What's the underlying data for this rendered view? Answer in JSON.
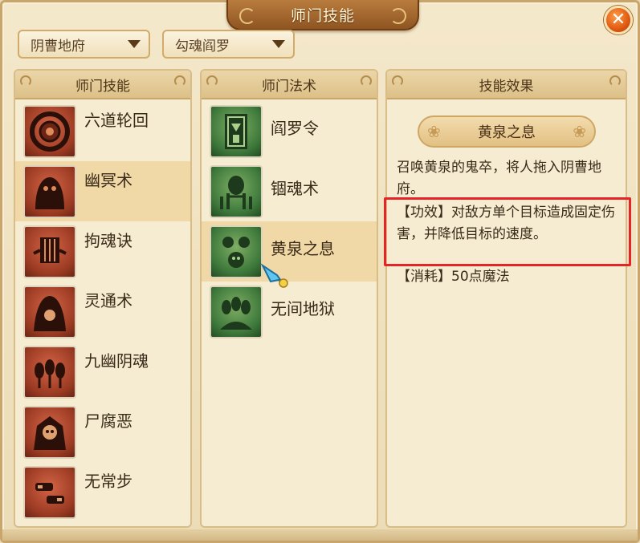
{
  "window": {
    "title": "师门技能",
    "close_label": "✕"
  },
  "dropdowns": [
    {
      "selected": "阴曹地府"
    },
    {
      "selected": "勾魂阎罗"
    }
  ],
  "school_panel": {
    "header": "师门技能",
    "items": [
      {
        "label": "六道轮回",
        "icon": "ring-icon"
      },
      {
        "label": "幽冥术",
        "icon": "ghosts-icon",
        "selected": true
      },
      {
        "label": "拘魂诀",
        "icon": "cage-ghost-icon"
      },
      {
        "label": "灵通术",
        "icon": "hooded-figure-icon"
      },
      {
        "label": "九幽阴魂",
        "icon": "three-spirits-icon"
      },
      {
        "label": "尸腐恶",
        "icon": "skull-icon"
      },
      {
        "label": "无常步",
        "icon": "footsteps-icon"
      }
    ]
  },
  "spell_panel": {
    "header": "师门法术",
    "items": [
      {
        "label": "阎罗令",
        "icon": "token-icon"
      },
      {
        "label": "锢魂术",
        "icon": "bound-soul-icon"
      },
      {
        "label": "黄泉之息",
        "icon": "skulls-icon",
        "selected": true
      },
      {
        "label": "无间地狱",
        "icon": "hell-ghosts-icon"
      }
    ]
  },
  "effect_panel": {
    "header": "技能效果",
    "skill_name": "黄泉之息",
    "description": "召唤黄泉的鬼卒，将人拖入阴曹地府。",
    "effect": "【功效】对敌方单个目标造成固定伤害，并降低目标的速度。",
    "cost": "【消耗】50点魔法"
  },
  "colors": {
    "highlight": "#e3252a",
    "accent": "#8f5522"
  }
}
